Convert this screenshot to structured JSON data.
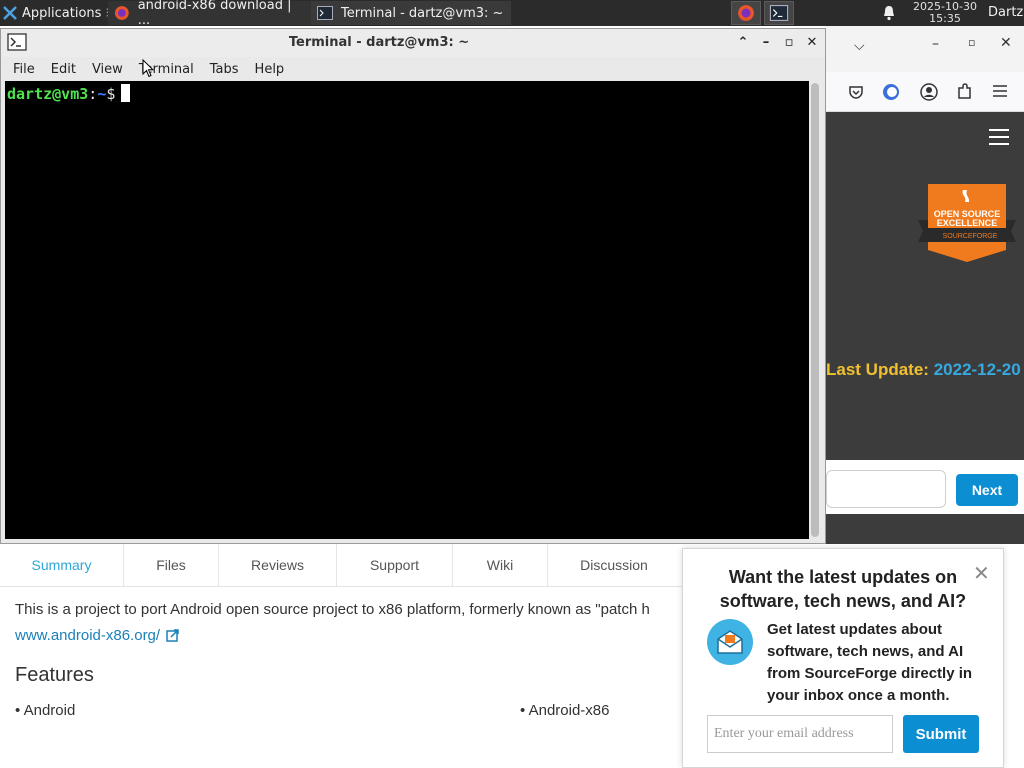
{
  "taskbar": {
    "applications_label": "Applications",
    "task1_label": "android-x86 download | ...",
    "task2_label": "Terminal - dartz@vm3: ~",
    "clock_date": "2025-10-30",
    "clock_time": "15:35",
    "user": "Dartz"
  },
  "terminal": {
    "title": "Terminal - dartz@vm3: ~",
    "menu": [
      "File",
      "Edit",
      "View",
      "Terminal",
      "Tabs",
      "Help"
    ],
    "prompt_user": "dartz@vm3",
    "prompt_sep": ":",
    "prompt_path": "~",
    "prompt_sign": "$"
  },
  "browser": {
    "last_update_label": "Last Update:",
    "last_update_value": "2022-12-20",
    "next_label": "Next",
    "badge_line1": "OPEN SOURCE",
    "badge_line2": "EXCELLENCE",
    "badge_brand": "SOURCEFORGE"
  },
  "page": {
    "tabs": [
      "Summary",
      "Files",
      "Reviews",
      "Support",
      "Wiki",
      "Discussion"
    ],
    "description": "This is a project to port Android open source project to x86 platform, formerly known as \"patch h",
    "link": "www.android-x86.org/",
    "features_heading": "Features",
    "feature1": "• Android",
    "feature2": "• Android-x86"
  },
  "popup": {
    "title": "Want the latest updates on software, tech news, and AI?",
    "body": "Get latest updates about software, tech news, and AI from SourceForge directly in your inbox once a month.",
    "email_placeholder": "Enter your email address",
    "submit_label": "Submit"
  },
  "colors": {
    "accent_blue": "#0b8ed2",
    "prompt_green": "#4fe34f",
    "update_yellow": "#f0c030"
  }
}
